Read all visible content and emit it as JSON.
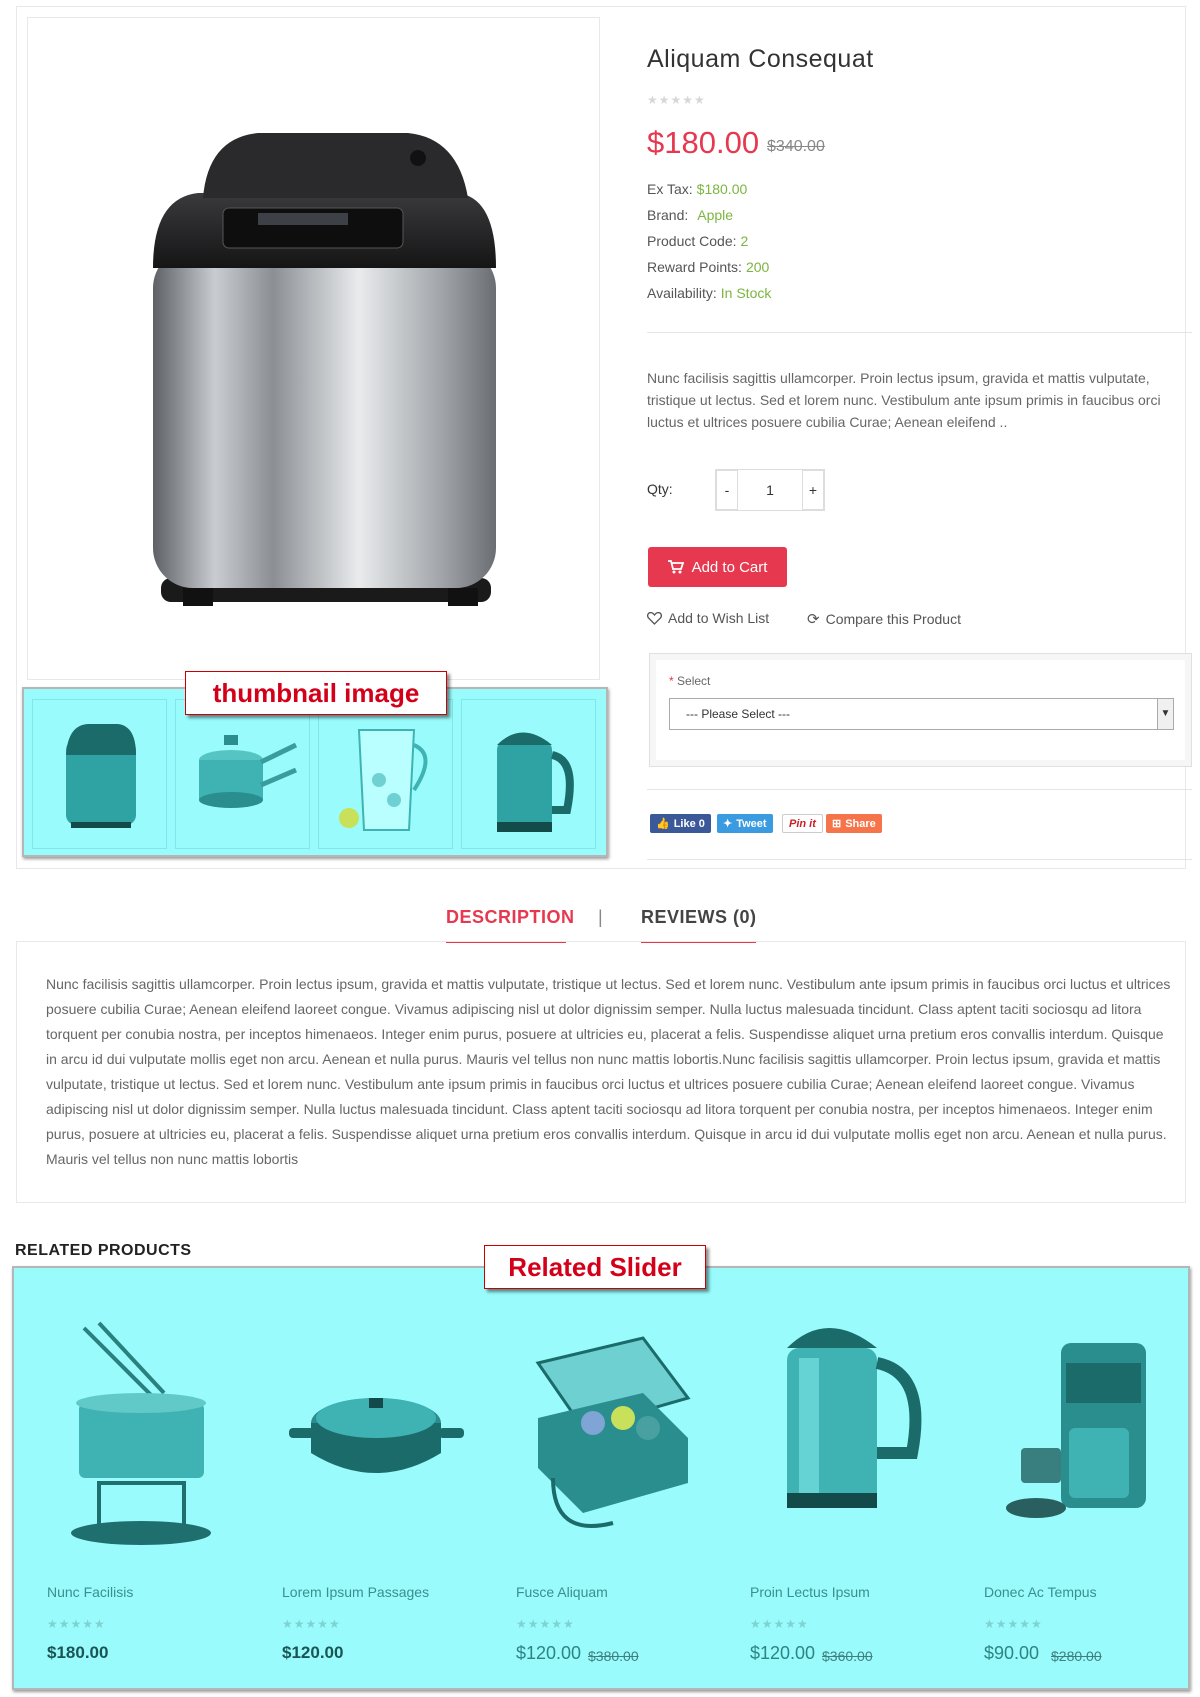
{
  "product": {
    "title": "Aliquam Consequat",
    "rating_stars": "★★★★★",
    "price": "$180.00",
    "old_price": "$340.00",
    "info": [
      {
        "label": "Ex Tax:",
        "value": "$180.00"
      },
      {
        "label": "Brand:",
        "value": "Apple"
      },
      {
        "label": "Product Code:",
        "value": "2"
      },
      {
        "label": "Reward Points:",
        "value": "200"
      },
      {
        "label": "Availability:",
        "value": "In Stock"
      }
    ],
    "short_description": "Nunc facilisis sagittis ullamcorper. Proin lectus ipsum, gravida et mattis vulputate, tristique ut lectus. Sed et lorem nunc. Vestibulum ante ipsum primis in faucibus orci luctus et ultrices posuere cubilia Curae; Aenean eleifend ..",
    "qty_label": "Qty:",
    "qty_value": "1",
    "qty_minus": "-",
    "qty_plus": "+",
    "add_to_cart": "Add to Cart",
    "wishlist": "Add to Wish List",
    "compare": "Compare this Product",
    "option_required": "*",
    "option_label": "Select",
    "option_selected": "--- Please Select ---"
  },
  "callouts": {
    "thumbnail": "thumbnail image",
    "related": "Related Slider"
  },
  "share": {
    "like": "Like 0",
    "tweet": "Tweet",
    "pinit": "Pin it",
    "share": "Share"
  },
  "tabs": {
    "description": "DESCRIPTION",
    "separator": "|",
    "reviews": "REVIEWS (0)"
  },
  "description_long": "Nunc facilisis sagittis ullamcorper. Proin lectus ipsum, gravida et mattis vulputate, tristique ut lectus. Sed et lorem nunc. Vestibulum ante ipsum primis in faucibus orci luctus et ultrices posuere cubilia Curae; Aenean eleifend laoreet congue. Vivamus adipiscing nisl ut dolor dignissim semper. Nulla luctus malesuada tincidunt. Class aptent taciti sociosqu ad litora torquent per conubia nostra, per inceptos himenaeos. Integer enim purus, posuere at ultricies eu, placerat a felis. Suspendisse aliquet urna pretium eros convallis interdum. Quisque in arcu id dui vulputate mollis eget non arcu. Aenean et nulla purus. Mauris vel tellus non nunc mattis lobortis.Nunc facilisis sagittis ullamcorper. Proin lectus ipsum, gravida et mattis vulputate, tristique ut lectus. Sed et lorem nunc. Vestibulum ante ipsum primis in faucibus orci luctus et ultrices posuere cubilia Curae; Aenean eleifend laoreet congue. Vivamus adipiscing nisl ut dolor dignissim semper. Nulla luctus malesuada tincidunt. Class aptent taciti sociosqu ad litora torquent per conubia nostra, per inceptos himenaeos. Integer enim purus, posuere at ultricies eu, placerat a felis. Suspendisse aliquet urna pretium eros convallis interdum. Quisque in arcu id dui vulputate mollis eget non arcu. Aenean et nulla purus. Mauris vel tellus non nunc mattis lobortis",
  "related": {
    "title": "RELATED PRODUCTS",
    "items": [
      {
        "name": "Nunc Facilisis",
        "price": "$180.00",
        "old_price": "",
        "stars": "★★★★★"
      },
      {
        "name": "Lorem Ipsum Passages",
        "price": "$120.00",
        "old_price": "",
        "stars": "★★★★★"
      },
      {
        "name": "Fusce Aliquam",
        "price": "$120.00",
        "old_price": "$380.00",
        "stars": "★★★★★"
      },
      {
        "name": "Proin Lectus Ipsum",
        "price": "$120.00",
        "old_price": "$360.00",
        "stars": "★★★★★"
      },
      {
        "name": "Donec Ac Tempus",
        "price": "$90.00",
        "old_price": "$280.00",
        "stars": "★★★★★"
      }
    ]
  },
  "colors": {
    "accent": "#e6384e",
    "green": "#7bb53f",
    "highlight": "#99fbfb"
  }
}
